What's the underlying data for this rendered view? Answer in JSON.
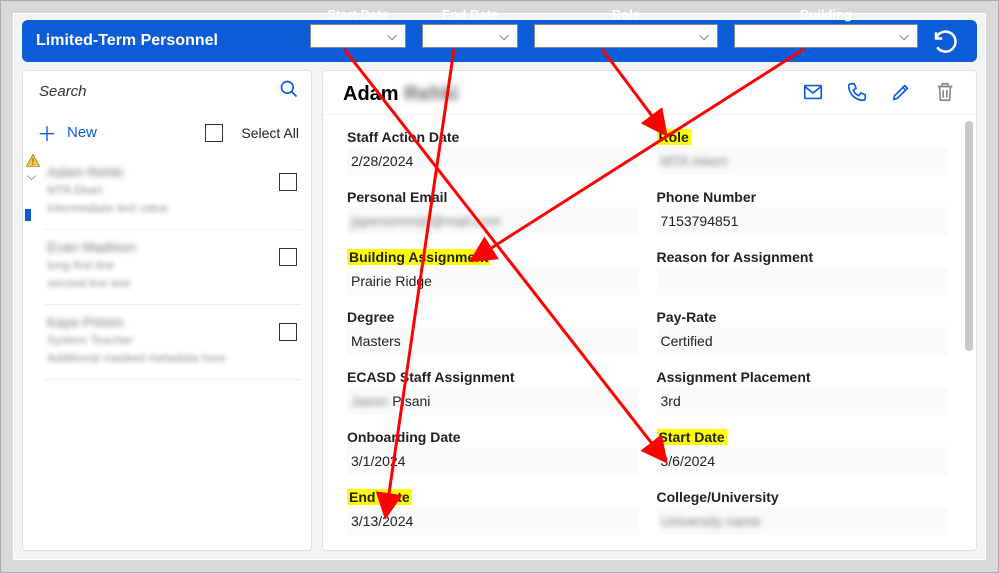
{
  "app": {
    "title": "Limited-Term Personnel"
  },
  "filters": {
    "start_date": {
      "label": "Start Date",
      "value": ""
    },
    "end_date": {
      "label": "End Date",
      "value": ""
    },
    "role": {
      "label": "Role",
      "value": ""
    },
    "building": {
      "label": "Building",
      "value": ""
    }
  },
  "sidebar": {
    "search_placeholder": "Search",
    "new_label": "New",
    "select_all_label": "Select All",
    "items": [
      {
        "selected": true
      },
      {
        "selected": false
      },
      {
        "selected": false
      }
    ]
  },
  "detail": {
    "name_first": "Adam",
    "fields": {
      "staff_action_date": {
        "label": "Staff Action Date",
        "value": "2/28/2024"
      },
      "role": {
        "label": "Role",
        "value": "",
        "highlight": true
      },
      "personal_email": {
        "label": "Personal Email",
        "value": ""
      },
      "phone_number": {
        "label": "Phone Number",
        "value": "7153794851"
      },
      "building_assignment": {
        "label": "Building Assignment",
        "value": "Prairie Ridge",
        "highlight": true
      },
      "reason_for_assignment": {
        "label": "Reason for Assignment",
        "value": ""
      },
      "degree": {
        "label": "Degree",
        "value": "Masters"
      },
      "pay_rate": {
        "label": "Pay-Rate",
        "value": "Certified"
      },
      "ecasd_staff_assignment": {
        "label": "ECASD Staff Assignment",
        "value": ""
      },
      "assignment_placement": {
        "label": "Assignment Placement",
        "value": "3rd"
      },
      "onboarding_date": {
        "label": "Onboarding Date",
        "value": "3/1/2024"
      },
      "start_date": {
        "label": "Start Date",
        "value": "3/6/2024",
        "highlight": true
      },
      "end_date": {
        "label": "End Date",
        "value": "3/13/2024",
        "highlight": true
      },
      "college_university": {
        "label": "College/University",
        "value": ""
      }
    }
  },
  "icons": {
    "search": "search-icon",
    "mail": "mail-icon",
    "phone": "phone-icon",
    "edit": "pencil-icon",
    "delete": "trash-icon",
    "undo": "undo-icon",
    "warn": "warning-icon",
    "chevron": "chevron-down-icon"
  },
  "colors": {
    "brand": "#0b5cd7",
    "highlight": "#ffff00",
    "arrow": "#ff0000"
  }
}
